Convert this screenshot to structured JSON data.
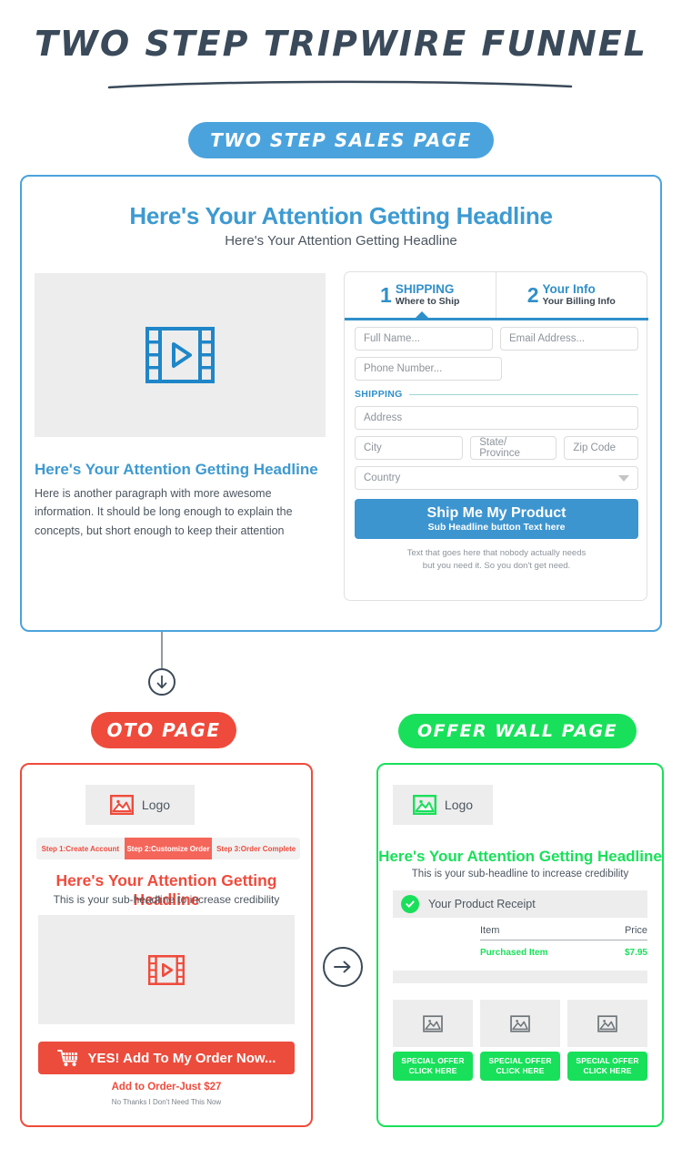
{
  "header": {
    "title": "TWO STEP TRIPWIRE FUNNEL",
    "sales_pill": "TWO STEP SALES PAGE",
    "oto_pill": "OTO PAGE",
    "offer_pill": "OFFER WALL PAGE"
  },
  "colors": {
    "blue": "#4ba3dd",
    "blue_text": "#3d9ad1",
    "blue_cta": "#3d95d0",
    "red": "#ef4b3c",
    "red_active": "#f4655a",
    "green": "#19e05a",
    "dark": "#3c4a57",
    "body_text": "#4c5660",
    "placeholder": "#8d949b",
    "panel_gray": "#ededed"
  },
  "sales_page": {
    "headline": "Here's Your Attention Getting Headline",
    "subheadline": "Here's Your Attention Getting Headline",
    "video_icon": "film-play-icon",
    "left_heading": "Here's Your Attention Getting Headline",
    "left_paragraph": "Here is another paragraph with more awesome information. It should be long enough to explain the concepts, but short enough to keep their attention",
    "form": {
      "tabs": [
        {
          "number": "1",
          "title": "SHIPPING",
          "subtitle": "Where to Ship",
          "active": true
        },
        {
          "number": "2",
          "title": "Your Info",
          "subtitle": "Your Billing Info",
          "active": false
        }
      ],
      "fields": {
        "full_name": "Full Name...",
        "email": "Email Address...",
        "phone": "Phone Number...",
        "section_label": "SHIPPING",
        "address": "Address",
        "city": "City",
        "state": "State/ Province",
        "zip": "Zip Code",
        "country": "Country"
      },
      "submit_main": "Ship Me My Product",
      "submit_sub": "Sub Headline button Text here",
      "fine_print_line1": "Text that goes here that nobody actually needs",
      "fine_print_line2": "but you need it. So you don't get need."
    }
  },
  "connectors": {
    "down_arrow": "arrow-down-icon",
    "right_arrow": "arrow-right-icon"
  },
  "oto_page": {
    "logo_label": "Logo",
    "logo_icon": "image-placeholder-icon",
    "steps": [
      {
        "label": "Step 1:Create Account",
        "active": false
      },
      {
        "label": "Step 2:Customize Order",
        "active": true
      },
      {
        "label": "Step 3:Order Complete",
        "active": false
      }
    ],
    "headline": "Here's Your Attention Getting Headline",
    "subheadline": "This is your sub-headline to increase credibility",
    "video_icon": "film-play-icon",
    "cta_icon": "shopping-cart-icon",
    "cta_label": "YES! Add To My Order Now...",
    "price_line": "Add to Order-Just $27",
    "decline_line": "No Thanks I Don't Need This Now"
  },
  "offer_wall_page": {
    "logo_label": "Logo",
    "logo_icon": "image-placeholder-icon",
    "headline": "Here's Your Attention Getting Headline",
    "subheadline": "This is your sub-headline to increase credibility",
    "receipt_icon": "check-circle-icon",
    "receipt_title": "Your Product Receipt",
    "table": {
      "headers": [
        "Item",
        "Price"
      ],
      "rows": [
        [
          "Purchased Item",
          "$7.95"
        ]
      ]
    },
    "tiles": [
      {
        "image_icon": "image-placeholder-icon",
        "line1": "SPECIAL OFFER",
        "line2": "CLICK HERE"
      },
      {
        "image_icon": "image-placeholder-icon",
        "line1": "SPECIAL OFFER",
        "line2": "CLICK HERE"
      },
      {
        "image_icon": "image-placeholder-icon",
        "line1": "SPECIAL OFFER",
        "line2": "CLICK HERE"
      }
    ]
  }
}
